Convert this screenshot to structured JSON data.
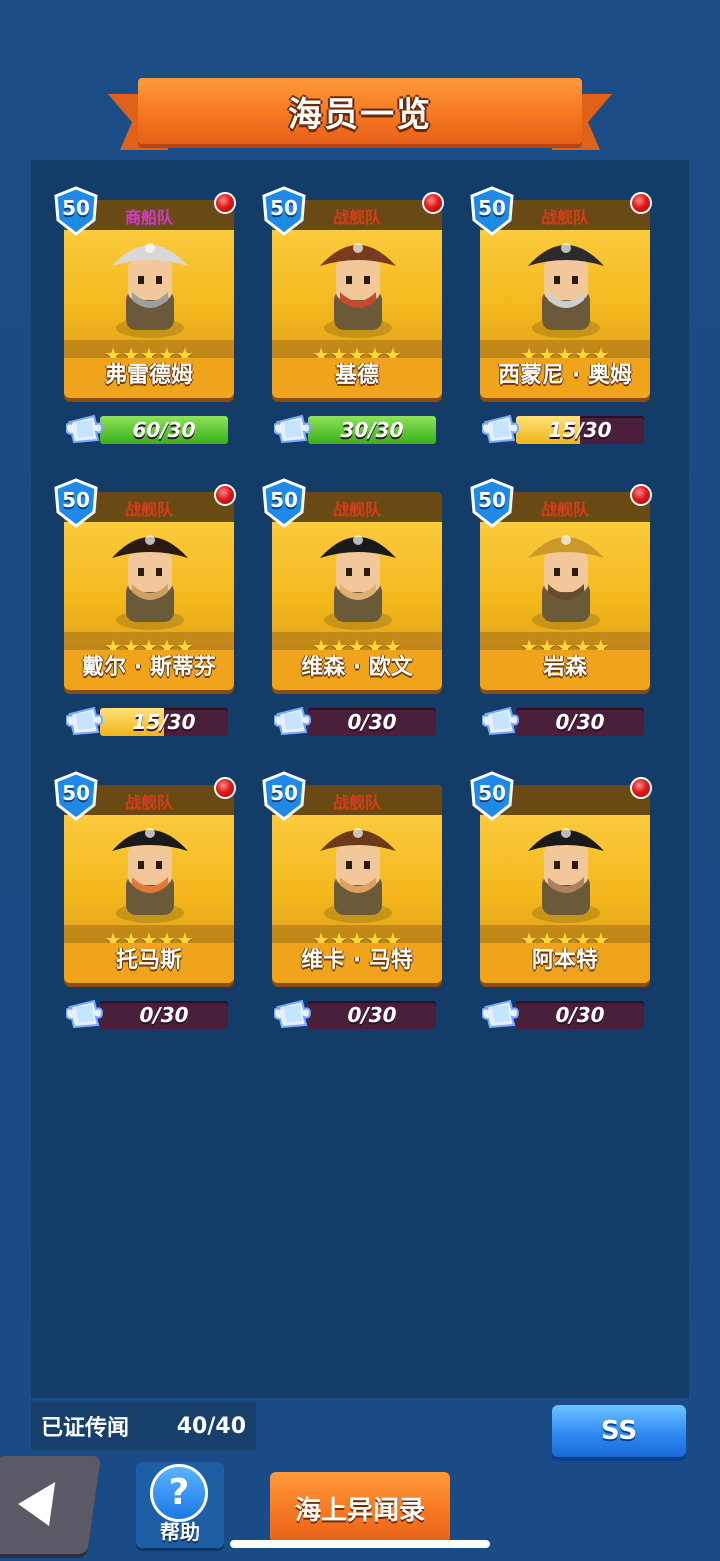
{
  "title": "海员一览",
  "cards": [
    {
      "level": "50",
      "team": "商船队",
      "team_type": "merchant",
      "name": "弗雷德姆",
      "stars": "★★★★★",
      "progress": "60/30",
      "progress_ratio": 1.0,
      "fill_color": "green",
      "alert": true
    },
    {
      "level": "50",
      "team": "战舰队",
      "team_type": "warship",
      "name": "基德",
      "stars": "★★★★★",
      "progress": "30/30",
      "progress_ratio": 1.0,
      "fill_color": "green",
      "alert": true
    },
    {
      "level": "50",
      "team": "战舰队",
      "team_type": "warship",
      "name": "西蒙尼 · 奥姆",
      "stars": "★★★★★",
      "progress": "15/30",
      "progress_ratio": 0.5,
      "fill_color": "yellow",
      "alert": true
    },
    {
      "level": "50",
      "team": "战舰队",
      "team_type": "warship",
      "name": "戴尔 · 斯蒂芬",
      "stars": "★★★★★",
      "progress": "15/30",
      "progress_ratio": 0.5,
      "fill_color": "yellow",
      "alert": true
    },
    {
      "level": "50",
      "team": "战舰队",
      "team_type": "warship",
      "name": "维森 · 欧文",
      "stars": "★★★★★",
      "progress": "0/30",
      "progress_ratio": 0,
      "fill_color": "yellow",
      "alert": false
    },
    {
      "level": "50",
      "team": "战舰队",
      "team_type": "warship",
      "name": "岩森",
      "stars": "★★★★★",
      "progress": "0/30",
      "progress_ratio": 0,
      "fill_color": "yellow",
      "alert": true
    },
    {
      "level": "50",
      "team": "战舰队",
      "team_type": "warship",
      "name": "托马斯",
      "stars": "★★★★★",
      "progress": "0/30",
      "progress_ratio": 0,
      "fill_color": "yellow",
      "alert": true
    },
    {
      "level": "50",
      "team": "战舰队",
      "team_type": "warship",
      "name": "维卡 · 马特",
      "stars": "★★★★★",
      "progress": "0/30",
      "progress_ratio": 0,
      "fill_color": "yellow",
      "alert": false
    },
    {
      "level": "50",
      "team": "",
      "team_type": "none",
      "name": "阿本特",
      "stars": "★★★★★",
      "progress": "0/30",
      "progress_ratio": 0,
      "fill_color": "yellow",
      "alert": true
    }
  ],
  "footer": {
    "proven_label": "已证传闻",
    "proven_count": "40/40",
    "ss_label": "SS",
    "help_label": "帮助",
    "log_label": "海上异闻录"
  }
}
